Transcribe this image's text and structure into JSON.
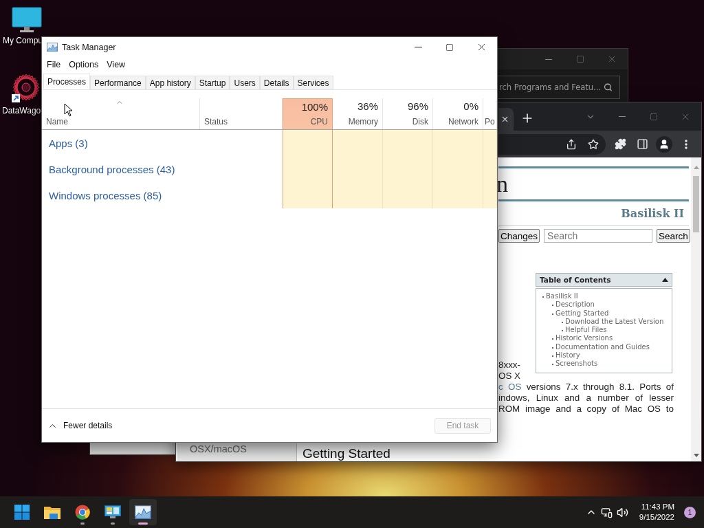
{
  "desktop": {
    "icons": [
      {
        "kind": "computer",
        "label": "My Compu"
      },
      {
        "kind": "shortcut",
        "label": "DataWago"
      }
    ]
  },
  "control_panel": {
    "search_placeholder": "rch Programs and Featu..."
  },
  "browser": {
    "page": {
      "heading": "n",
      "site_title": "Basilisk II",
      "link_button": "Changes",
      "search_placeholder": "Search",
      "search_button": "Search",
      "toc": {
        "title": "Table of Contents",
        "expanded": true,
        "items": [
          {
            "label": "Basilisk II",
            "children": [
              {
                "label": "Description"
              },
              {
                "label": "Getting Started",
                "children": [
                  {
                    "label": "Download the Latest Version"
                  },
                  {
                    "label": "Helpful Files"
                  }
                ]
              },
              {
                "label": "Historic Versions"
              },
              {
                "label": "Documentation and Guides"
              },
              {
                "label": "History"
              },
              {
                "label": "Screenshots"
              }
            ]
          }
        ]
      },
      "paragraph_lines": [
        {
          "kind": "short",
          "text": "8xxx-"
        },
        {
          "kind": "short",
          "text": "OS X"
        },
        {
          "kind": "full",
          "link": "c OS",
          "text": " versions 7.x through 8.1. Ports of"
        },
        {
          "kind": "full",
          "text": "indows, Linux and a number of lesser"
        },
        {
          "kind": "full",
          "text": "ROM image and a copy of Mac OS to"
        }
      ],
      "sidebar_lines": [
        "OSX/macOS"
      ],
      "section_heading": "Getting Started"
    }
  },
  "task_manager": {
    "title": "Task Manager",
    "menu": [
      "File",
      "Options",
      "View"
    ],
    "tabs": [
      {
        "label": "Processes",
        "selected": true
      },
      {
        "label": "Performance",
        "selected": false
      },
      {
        "label": "App history",
        "selected": false
      },
      {
        "label": "Startup",
        "selected": false
      },
      {
        "label": "Users",
        "selected": false
      },
      {
        "label": "Details",
        "selected": false
      },
      {
        "label": "Services",
        "selected": false
      }
    ],
    "columns": [
      {
        "kind": "text",
        "label": "Name"
      },
      {
        "kind": "text",
        "label": "Status"
      },
      {
        "kind": "metric",
        "value": "100%",
        "label": "CPU",
        "color": "#f9c3a6"
      },
      {
        "kind": "metric",
        "value": "36%",
        "label": "Memory",
        "color": "#ffffff"
      },
      {
        "kind": "metric",
        "value": "96%",
        "label": "Disk",
        "color": "#ffffff"
      },
      {
        "kind": "metric",
        "value": "0%",
        "label": "Network",
        "color": "#ffffff"
      },
      {
        "kind": "metric",
        "label": "Po"
      }
    ],
    "groups": [
      {
        "label": "Apps (3)"
      },
      {
        "label": "Background processes (43)"
      },
      {
        "label": "Windows processes (85)"
      }
    ],
    "footer": {
      "toggle": "Fewer details",
      "end_task": {
        "label": "End task",
        "disabled": true
      }
    }
  },
  "taskbar": {
    "apps": [
      {
        "kind": "start",
        "running": false,
        "active": false
      },
      {
        "kind": "explorer",
        "running": false,
        "active": false
      },
      {
        "kind": "chrome",
        "running": true,
        "active": false
      },
      {
        "kind": "control_panel",
        "running": true,
        "active": false
      },
      {
        "kind": "task_manager",
        "running": true,
        "active": true
      }
    ],
    "clock": {
      "time": "11:43 PM",
      "date": "9/15/2022"
    },
    "notification_count": "1"
  }
}
